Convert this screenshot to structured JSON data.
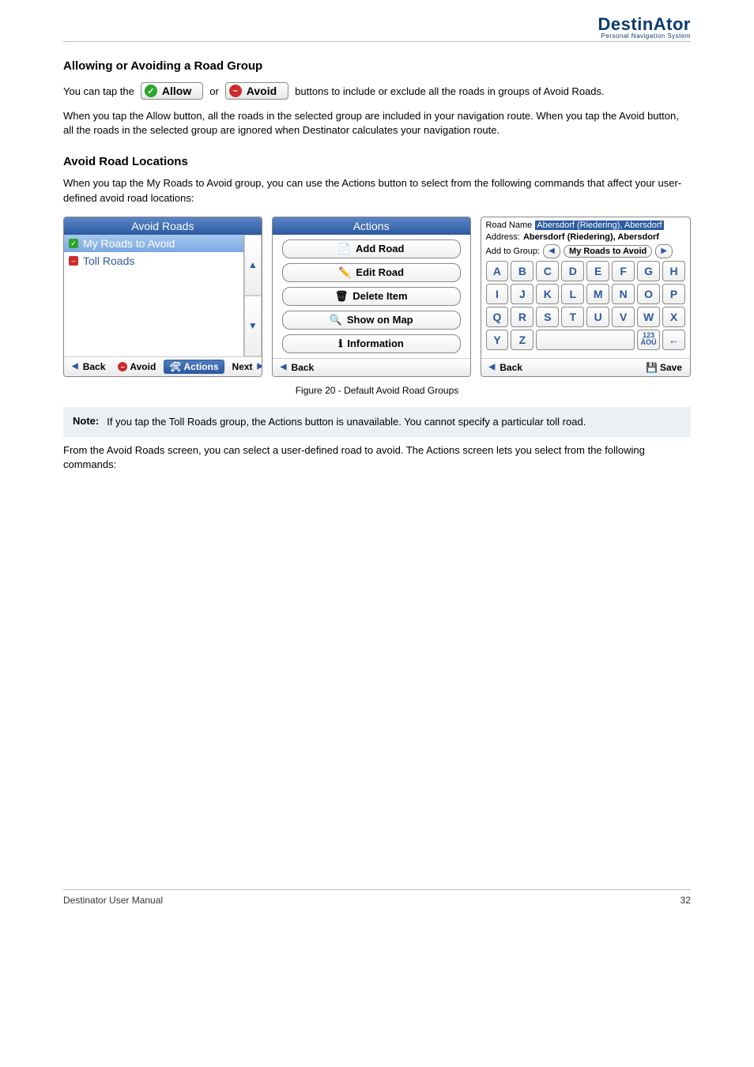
{
  "header": {
    "brand_main": "DestinAtor",
    "brand_sub": "Personal Navigation System"
  },
  "section1": {
    "title": "Allowing or Avoiding a Road Group"
  },
  "para1a": "You can tap the",
  "allow_btn": {
    "label": "Allow"
  },
  "para1b": "or",
  "avoid_btn": {
    "label": "Avoid"
  },
  "para1c": "buttons to include or exclude all the roads in groups of Avoid Roads.",
  "para2": "When you tap the Allow button, all the roads in the selected group are included in your navigation route. When you tap the Avoid button, all the roads in the selected group are ignored when Destinator calculates your navigation route.",
  "section2": {
    "title": "Avoid Road Locations"
  },
  "para3": "When you tap the My Roads to Avoid group, you can use the Actions button to select from the following commands that affect your user-defined avoid road locations:",
  "panel_avoid": {
    "title": "Avoid Roads",
    "item_selected": "My Roads to Avoid",
    "item_toll": "Toll Roads",
    "footer": {
      "back": "Back",
      "avoid": "Avoid",
      "actions": "Actions",
      "next": "Next"
    }
  },
  "panel_actions": {
    "title": "Actions",
    "items": [
      "Add Road",
      "Edit Road",
      "Delete Item",
      "Show on Map",
      "Information"
    ],
    "footer": {
      "back": "Back"
    }
  },
  "panel_kbd": {
    "road_name_label": "Road Name",
    "road_name_value": "Abersdorf (Riedering), Abersdorf",
    "address_label": "Address:",
    "address_value": "Abersdorf (Riedering), Abersdorf",
    "group_label": "Add to Group:",
    "group_value": "My Roads to Avoid",
    "rows": [
      [
        "A",
        "B",
        "C",
        "D",
        "E",
        "F",
        "G",
        "H"
      ],
      [
        "I",
        "J",
        "K",
        "L",
        "M",
        "N",
        "O",
        "P"
      ],
      [
        "Q",
        "R",
        "S",
        "T",
        "U",
        "V",
        "W",
        "X"
      ]
    ],
    "y": "Y",
    "z": "Z",
    "num_top": "123",
    "num_bot": "ÄÖÜ",
    "bksp": "←",
    "footer": {
      "back": "Back",
      "save": "Save"
    }
  },
  "fig_caption": "Figure 20 - Default Avoid Road Groups",
  "note": {
    "label": "Note:",
    "text": "If you tap the Toll Roads group, the Actions button is unavailable. You cannot specify a particular toll road."
  },
  "para4": "From the Avoid Roads screen, you can select a user-defined road to avoid. The Actions screen lets you select from the following commands:",
  "footer": {
    "left": "Destinator User Manual",
    "right": "32"
  }
}
